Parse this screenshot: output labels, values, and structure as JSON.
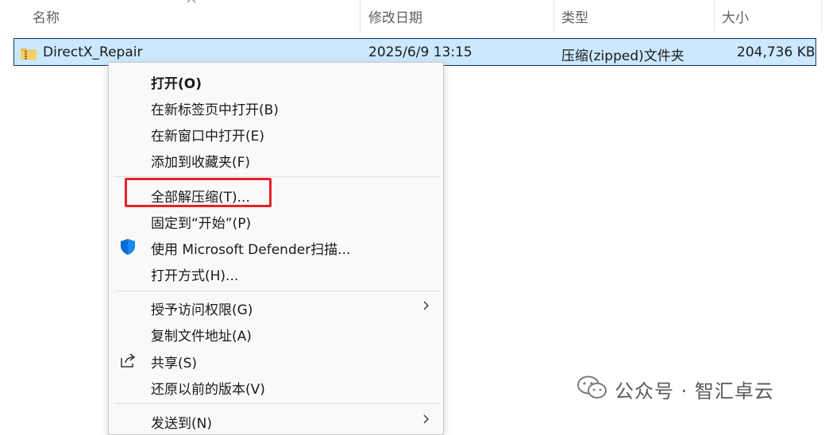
{
  "columns": {
    "name": "名称",
    "modified": "修改日期",
    "type": "类型",
    "size": "大小"
  },
  "file": {
    "name": "DirectX_Repair",
    "modified": "2025/6/9 13:15",
    "type": "压缩(zipped)文件夹",
    "size": "204,736 KB"
  },
  "context_menu": {
    "items": [
      {
        "label": "打开(O)",
        "bold": true
      },
      {
        "label": "在新标签页中打开(B)"
      },
      {
        "label": "在新窗口中打开(E)"
      },
      {
        "label": "添加到收藏夹(F)"
      },
      {
        "label": "全部解压缩(T)...",
        "highlighted": true
      },
      {
        "label": "固定到“开始”(P)"
      },
      {
        "label": "使用 Microsoft Defender扫描...",
        "icon": "shield-icon"
      },
      {
        "label": "打开方式(H)..."
      },
      {
        "label": "授予访问权限(G)",
        "submenu": true
      },
      {
        "label": "复制文件地址(A)"
      },
      {
        "label": "共享(S)",
        "icon": "share-icon"
      },
      {
        "label": "还原以前的版本(V)"
      },
      {
        "label": "发送到(N)",
        "submenu": true
      }
    ]
  },
  "watermark": {
    "text": "公众号 · 智汇卓云",
    "icon": "wechat-icon"
  },
  "colors": {
    "selection": "#cce8ff",
    "highlight_box": "#e8202a",
    "defender_shield": "#0a6cd4"
  }
}
